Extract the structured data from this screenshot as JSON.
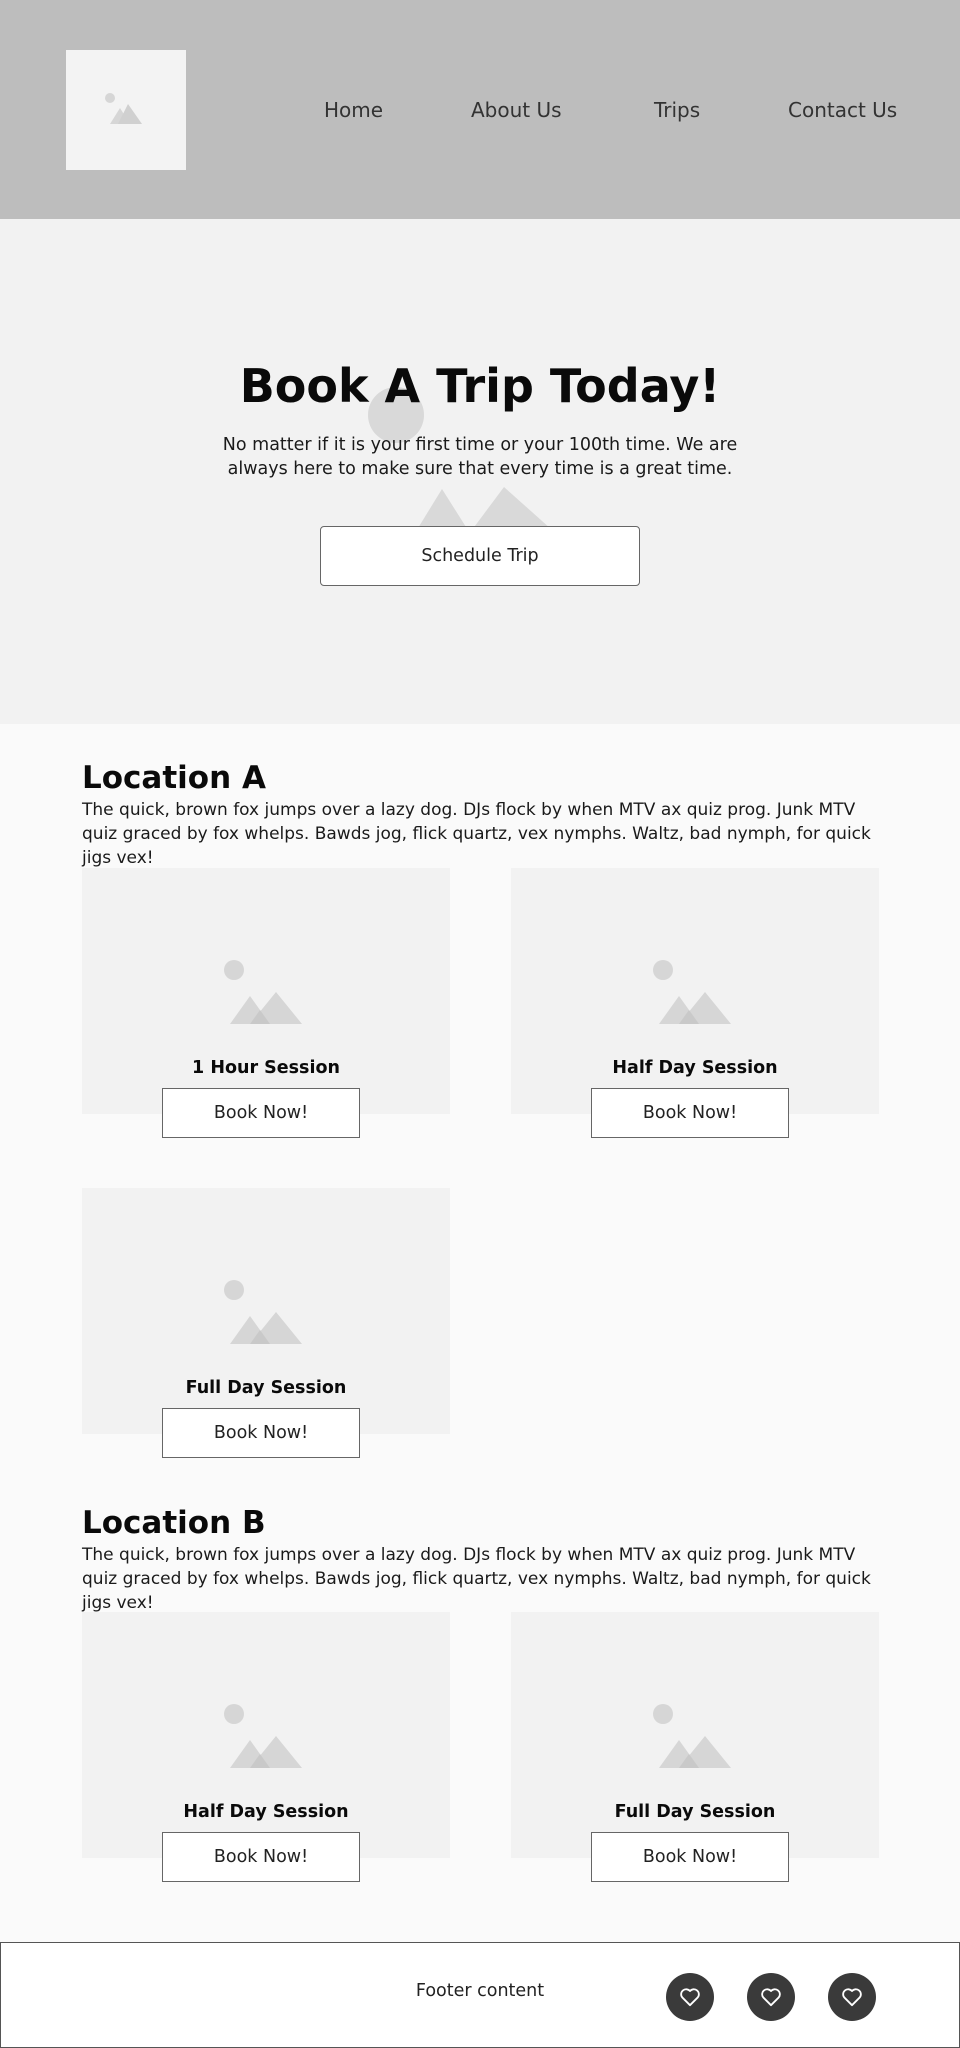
{
  "header": {
    "nav": [
      "Home",
      "About Us",
      "Trips",
      "Contact Us"
    ]
  },
  "hero": {
    "title": "Book A Trip Today!",
    "subtitle": "No matter if it is your first time or your 100th time. We are always here to make sure that every time is a great time.",
    "button_label": "Schedule Trip"
  },
  "locations": [
    {
      "title": "Location A",
      "description": "The quick, brown fox jumps over a lazy dog. DJs flock by when MTV ax quiz prog. Junk MTV quiz graced by fox whelps. Bawds jog, flick quartz, vex nymphs. Waltz, bad nymph, for quick jigs vex!",
      "cards": [
        {
          "title": "1 Hour Session",
          "button_label": "Book Now!"
        },
        {
          "title": "Half Day Session",
          "button_label": "Book Now!"
        },
        {
          "title": "Full Day Session",
          "button_label": "Book Now!"
        }
      ]
    },
    {
      "title": "Location B",
      "description": "The quick, brown fox jumps over a lazy dog. DJs flock by when MTV ax quiz prog. Junk MTV quiz graced by fox whelps. Bawds jog, flick quartz, vex nymphs. Waltz, bad nymph, for quick jigs vex!",
      "cards": [
        {
          "title": "Half Day Session",
          "button_label": "Book Now!"
        },
        {
          "title": "Full Day Session",
          "button_label": "Book Now!"
        }
      ]
    }
  ],
  "footer": {
    "text": "Footer content",
    "social_icons": [
      "heart-icon",
      "heart-icon",
      "heart-icon"
    ]
  },
  "colors": {
    "header_bg": "#bdbdbd",
    "hero_bg": "#f2f2f2",
    "card_bg": "#f2f2f2",
    "social_bg": "#3a3a3a"
  }
}
